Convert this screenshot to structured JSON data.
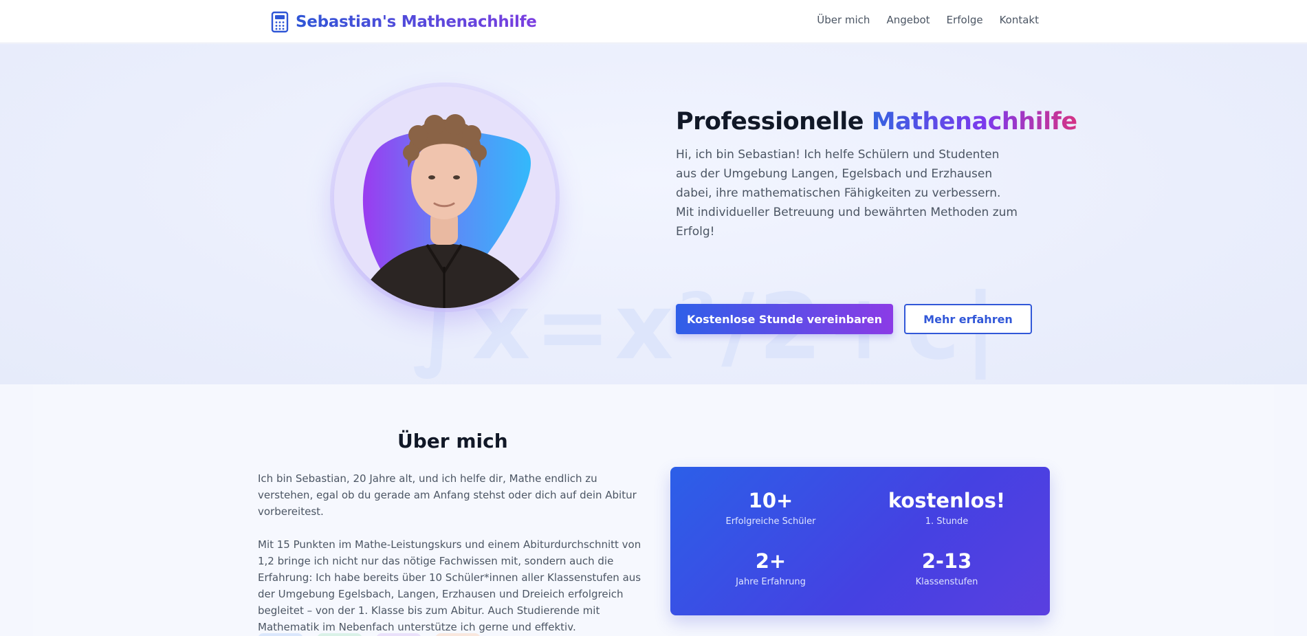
{
  "header": {
    "brand_text": "Sebastian's Mathenachhilfe",
    "brand_icon": "calculator-icon",
    "nav": [
      "Über mich",
      "Angebot",
      "Erfolge",
      "Kontakt"
    ]
  },
  "hero": {
    "title_plain": "Professionelle ",
    "title_accent": "Mathenachhilfe",
    "text": "Hi, ich bin Sebastian! Ich helfe Schülern und Studenten aus der Umgebung Langen, Egelsbach und Erzhausen dabei, ihre mathematischen Fähigkeiten zu verbessern. Mit individueller Betreuung und bewährten Methoden zum Erfolg!",
    "primary_button": "Kostenlose Stunde vereinbaren",
    "secondary_button": "Mehr erfahren",
    "background_formula": "∫x=x²/2+c|"
  },
  "about": {
    "title": "Über mich",
    "paragraphs": [
      "Ich bin Sebastian, 20 Jahre alt, und ich helfe dir, Mathe endlich zu verstehen, egal ob du gerade am Anfang stehst oder dich auf dein Abitur vorbereitest.",
      "Mit 15 Punkten im Mathe-Leistungskurs und einem Abiturdurchschnitt von 1,2 bringe ich nicht nur das nötige Fachwissen mit, sondern auch die Erfahrung: Ich habe bereits über 10 Schüler*innen aller Klassenstufen aus der Umgebung Egelsbach, Langen, Erzhausen und Dreieich erfolgreich begleitet – von der 1. Klasse bis zum Abitur. Auch Studierende mit Mathematik im Nebenfach unterstütze ich gerne und effektiv."
    ],
    "stats": [
      {
        "value": "10+",
        "label": "Erfolgreiche Schüler"
      },
      {
        "value": "kostenlos!",
        "label": "1. Stunde"
      },
      {
        "value": "2+",
        "label": "Jahre Erfahrung"
      },
      {
        "value": "2-13",
        "label": "Klassenstufen"
      }
    ]
  },
  "colors": {
    "brand_blue": "#2f56d6",
    "brand_purple": "#7b3ee0",
    "accent_pink": "#d63384",
    "card_blue": "#2c5fe8"
  }
}
